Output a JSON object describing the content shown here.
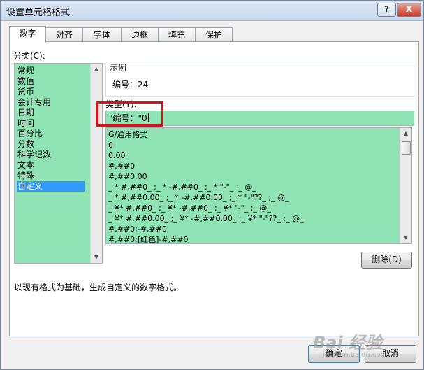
{
  "window": {
    "title": "设置单元格格式",
    "help_label": "?",
    "close_label": "X"
  },
  "tabs": [
    {
      "label": "数字",
      "active": true
    },
    {
      "label": "对齐"
    },
    {
      "label": "字体"
    },
    {
      "label": "边框"
    },
    {
      "label": "填充"
    },
    {
      "label": "保护"
    }
  ],
  "category": {
    "label": "分类(C):",
    "items": [
      "常规",
      "数值",
      "货币",
      "会计专用",
      "日期",
      "时间",
      "百分比",
      "分数",
      "科学记数",
      "文本",
      "特殊",
      "自定义"
    ],
    "selected": "自定义"
  },
  "sample": {
    "legend": "示例",
    "value": "编号：24"
  },
  "type": {
    "label": "类型(T):",
    "input_value": "\"编号：\"0",
    "list": [
      "G/通用格式",
      "0",
      "0.00",
      "#,##0",
      "#,##0.00",
      "_ * #,##0_ ;_ * -#,##0_ ;_ * \"-\"_ ;_ @_",
      "_ * #,##0.00_ ;_ * -#,##0.00_ ;_ * \"-\"??_ ;_ @_",
      "_ ¥* #,##0_ ;_ ¥* -#,##0_ ;_ ¥* \"-\"_ ;_ @_",
      "_ ¥* #,##0.00_ ;_ ¥* -#,##0.00_ ;_ ¥* \"-\"??_ ;_ @_",
      "#,##0;-#,##0",
      "#,##0;[红色]-#,##0"
    ]
  },
  "delete_label": "删除(D)",
  "description": "以现有格式为基础，生成自定义的数字格式。",
  "ok_label": "确定",
  "cancel_label": "取消",
  "watermark": {
    "logo": "Bai 经验",
    "sub": "jingyan.baidu.com"
  },
  "colors": {
    "list_bg": "#90e3b4",
    "selection": "#3399ff",
    "highlight_box": "#e01010"
  }
}
